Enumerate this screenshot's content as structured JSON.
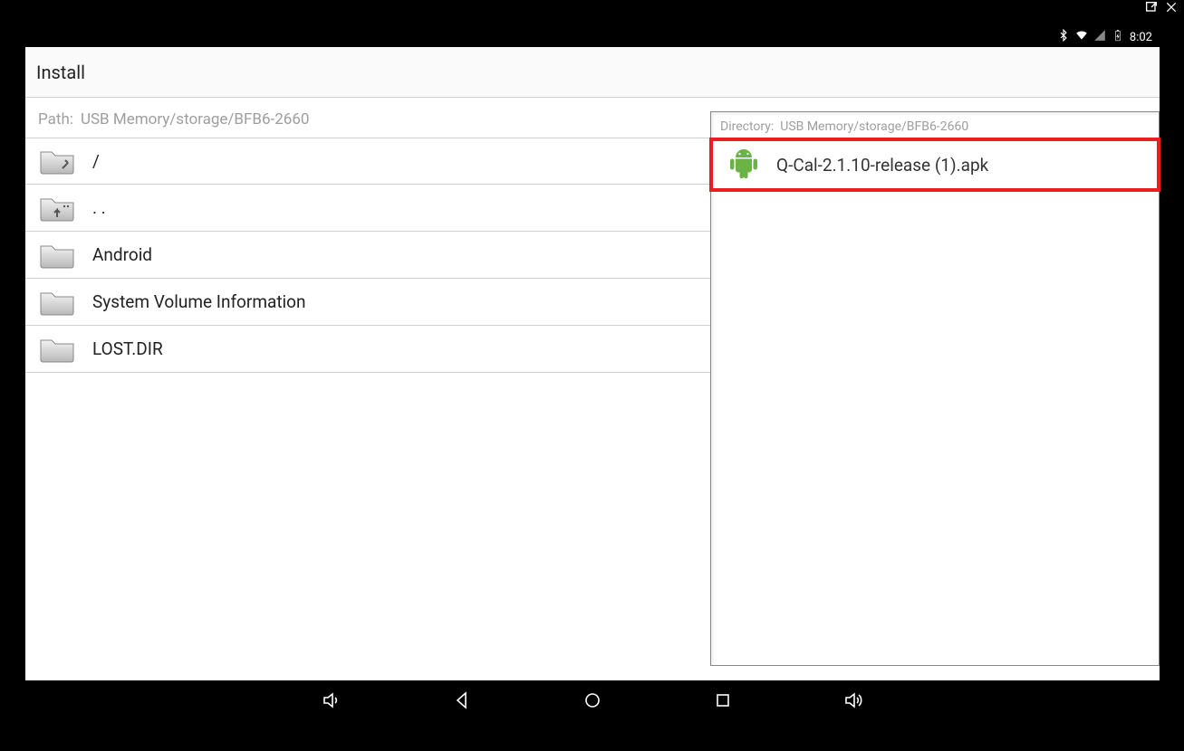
{
  "window": {
    "title": "Install"
  },
  "status_bar": {
    "time": "8:02"
  },
  "path": {
    "label": "Path:",
    "value": "USB Memory/storage/BFB6-2660"
  },
  "directories": [
    {
      "name": "/",
      "icon": "up-root"
    },
    {
      "name": ". .",
      "icon": "up-parent"
    },
    {
      "name": "Android",
      "icon": "folder"
    },
    {
      "name": "System Volume Information",
      "icon": "folder"
    },
    {
      "name": "LOST.DIR",
      "icon": "folder"
    }
  ],
  "right": {
    "dir_label": "Directory:",
    "dir_value": "USB Memory/storage/BFB6-2660",
    "file": {
      "name": "Q-Cal-2.1.10-release (1).apk",
      "icon": "android-apk"
    }
  }
}
